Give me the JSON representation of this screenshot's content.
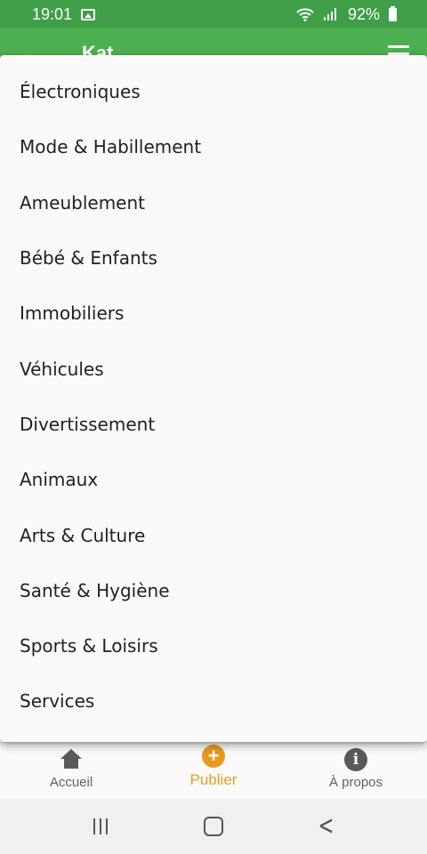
{
  "status_bar": {
    "time": "19:01",
    "battery": "92%",
    "icons": [
      "gallery-icon",
      "wifi-icon",
      "signal-icon",
      "battery-icon"
    ]
  },
  "app_bar": {
    "title": "Kat",
    "icons": [
      "back-arrow-icon",
      "menu-icon"
    ]
  },
  "dropdown": {
    "items": [
      "Électroniques",
      "Mode & Habillement",
      "Ameublement",
      "Bébé & Enfants",
      "Immobiliers",
      "Véhicules",
      "Divertissement",
      "Animaux",
      "Arts & Culture",
      "Santé & Hygiène",
      "Sports & Loisirs",
      "Services"
    ]
  },
  "bottom_nav": {
    "items": [
      {
        "label": "Accueil",
        "icon": "home-icon",
        "active": false
      },
      {
        "label": "Publier",
        "icon": "plus-circle-icon",
        "active": true
      },
      {
        "label": "À propos",
        "icon": "info-icon",
        "active": false
      }
    ]
  },
  "colors": {
    "status_bar": "#3f9e47",
    "app_bar": "#4caf50",
    "accent": "#e8a020",
    "menu_text": "#212121"
  }
}
